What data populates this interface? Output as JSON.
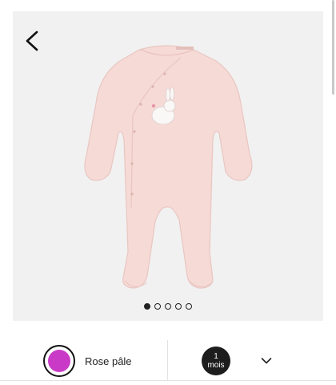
{
  "gallery": {
    "image_name": "pink-bunny-footed-sleepsuit",
    "slide_count": 5,
    "active_slide": 1
  },
  "icons": {
    "back": "chevron-left-icon",
    "dropdown": "chevron-down-icon"
  },
  "color": {
    "label": "Rose pâle",
    "swatch_hex": "#c93bc7"
  },
  "size": {
    "value": "1",
    "unit": "mois"
  },
  "colors": {
    "garment": "#f6dad6",
    "background": "#f1f1f1",
    "text": "#222222"
  }
}
